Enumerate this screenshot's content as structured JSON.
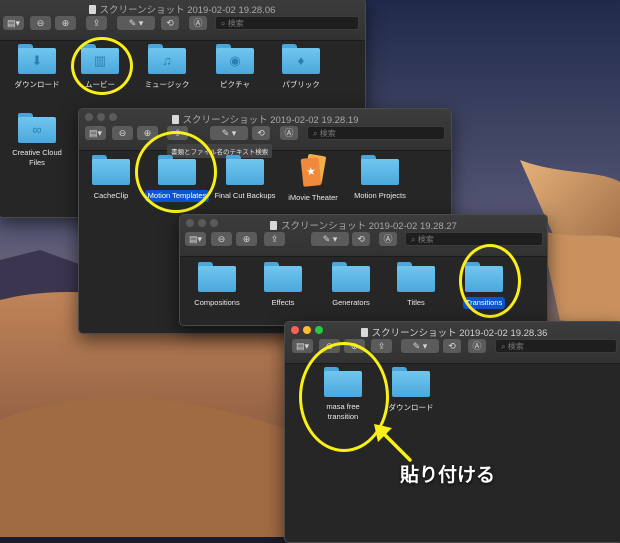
{
  "accent_colors": {
    "highlight_ring": "#f9f018",
    "selection": "#0b56d0",
    "folder": "#5db8e8"
  },
  "search_placeholder": "検索",
  "tooltip_text": "書類とファイル名のテキスト検索",
  "windows": {
    "w1": {
      "title": "スクリーンショット 2019-02-02 19.28.06",
      "items": [
        {
          "label": "ダウンロード",
          "icon": "download-icon"
        },
        {
          "label": "ムービー",
          "icon": "film-icon"
        },
        {
          "label": "ミュージック",
          "icon": "music-note-icon"
        },
        {
          "label": "ピクチャ",
          "icon": "camera-icon"
        },
        {
          "label": "パブリック",
          "icon": "public-icon"
        },
        {
          "label": "Creative Cloud Files",
          "icon": "creative-cloud-icon"
        }
      ]
    },
    "w2": {
      "title": "スクリーンショット 2019-02-02 19.28.19",
      "items": [
        {
          "label": "CacheClip"
        },
        {
          "label": "Motion Templates",
          "selected": true
        },
        {
          "label": "Final Cut Backups"
        },
        {
          "label": "iMovie Theater",
          "icon": "ticket-icon"
        },
        {
          "label": "Motion Projects"
        }
      ]
    },
    "w3": {
      "title": "スクリーンショット 2019-02-02 19.28.27",
      "items": [
        {
          "label": "Compositions"
        },
        {
          "label": "Effects"
        },
        {
          "label": "Generators"
        },
        {
          "label": "Titles"
        },
        {
          "label": "Transitions",
          "selected": true
        }
      ]
    },
    "w4": {
      "title": "スクリーンショット 2019-02-02 19.28.36",
      "items": [
        {
          "label": "masa free transition"
        },
        {
          "label": "ダウンロード"
        }
      ]
    }
  },
  "annotation": {
    "paste_label": "貼り付ける",
    "arrow_icon": "arrow-up-left-icon"
  }
}
